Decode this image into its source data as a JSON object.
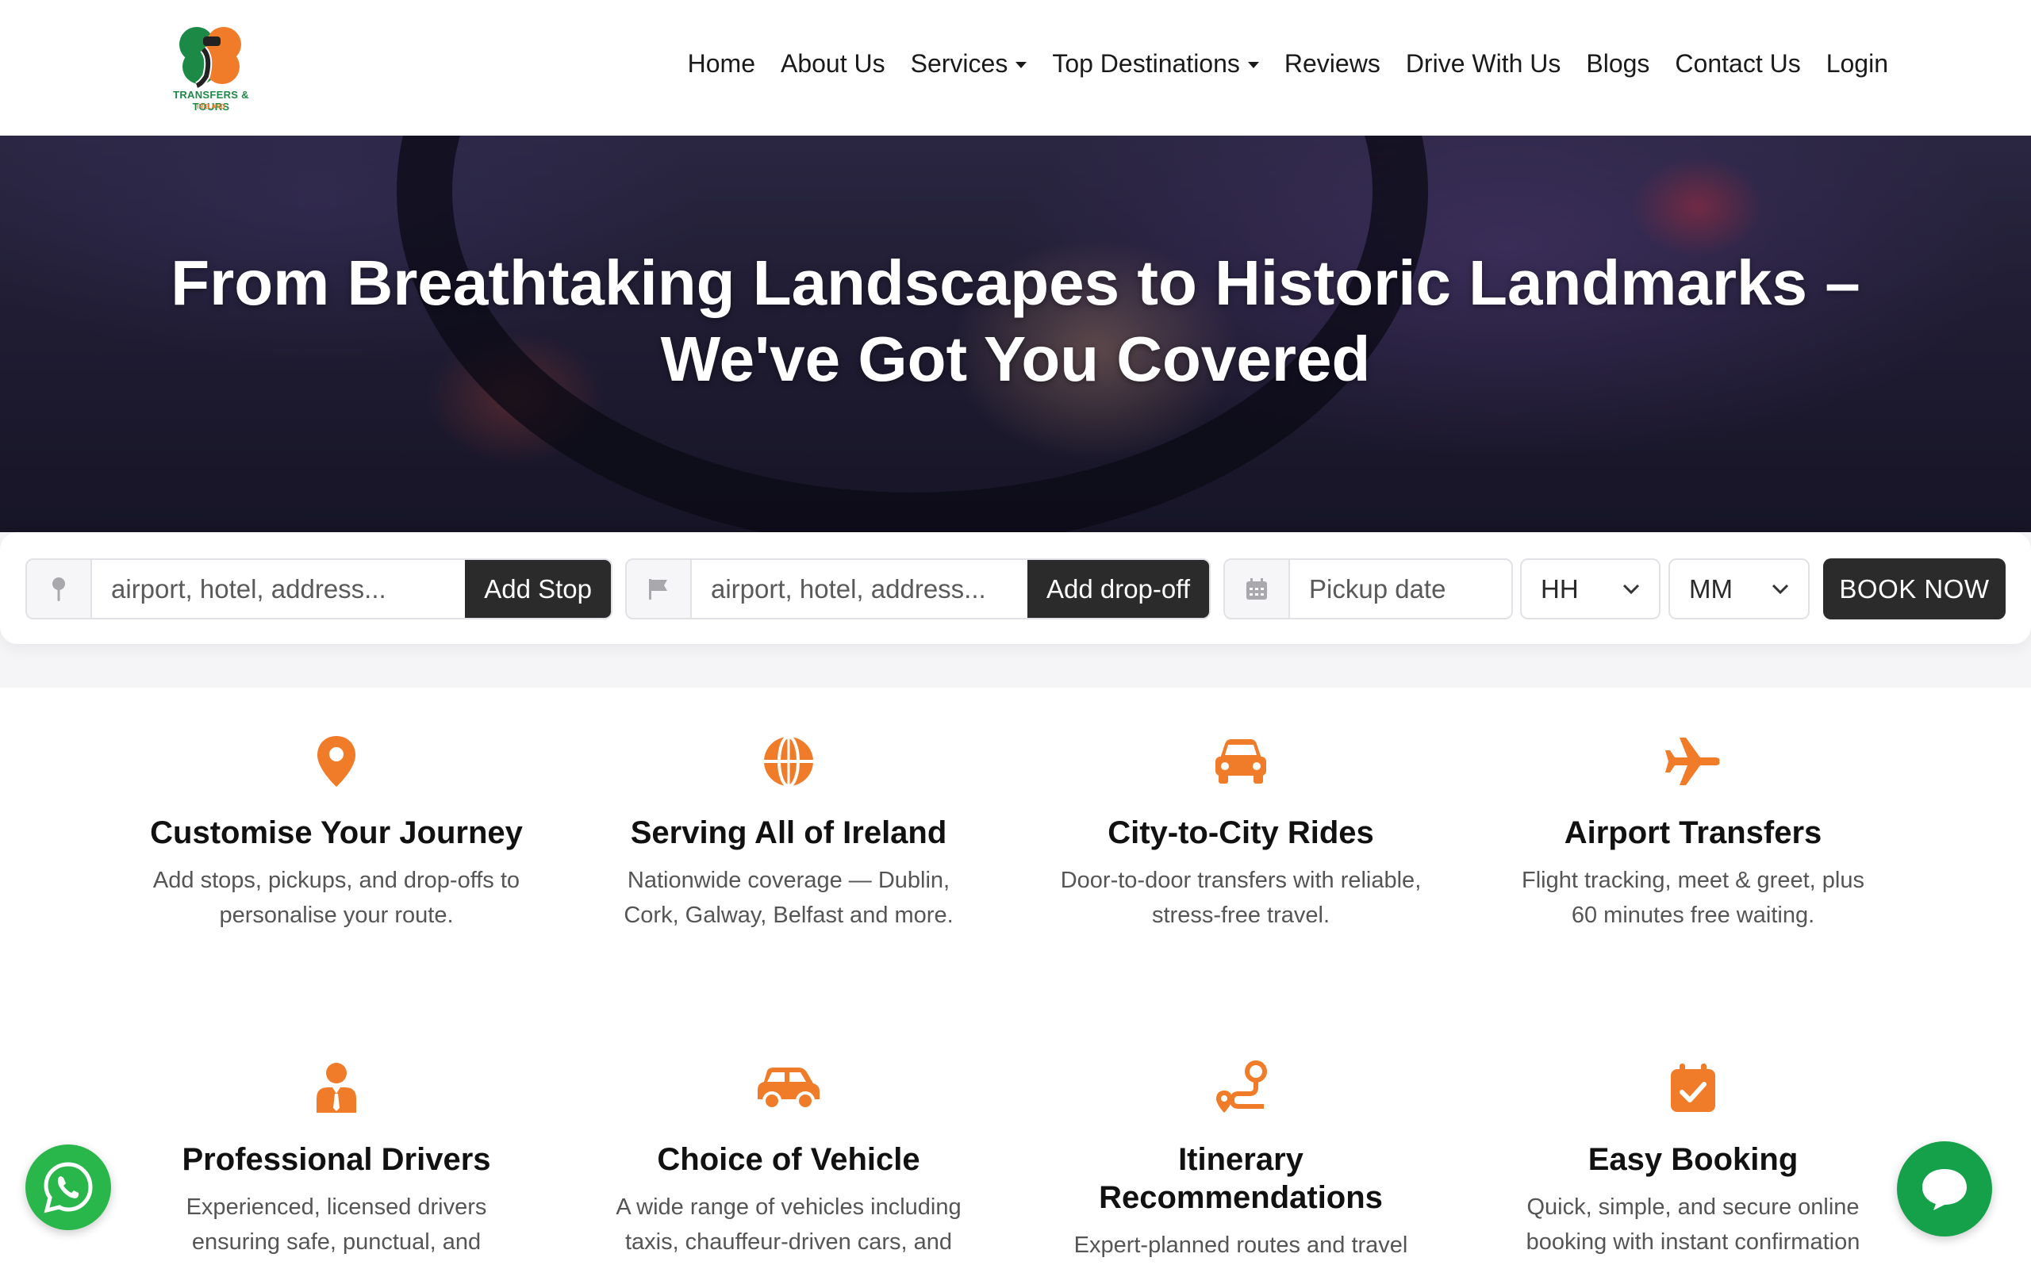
{
  "brand": {
    "logo_text": "TRANSFERS & TOURS",
    "logo_sub": "IRELAND",
    "colors": {
      "orange": "#f07c2a",
      "green": "#1c8a46",
      "dark": "#2b2b2b"
    }
  },
  "nav": {
    "items": [
      {
        "label": "Home",
        "dropdown": false
      },
      {
        "label": "About Us",
        "dropdown": false
      },
      {
        "label": "Services",
        "dropdown": true
      },
      {
        "label": "Top Destinations",
        "dropdown": true
      },
      {
        "label": "Reviews",
        "dropdown": false
      },
      {
        "label": "Drive With Us",
        "dropdown": false
      },
      {
        "label": "Blogs",
        "dropdown": false
      },
      {
        "label": "Contact Us",
        "dropdown": false
      },
      {
        "label": "Login",
        "dropdown": false
      }
    ]
  },
  "hero": {
    "title_line1": "From Breathtaking Landscapes to Historic Landmarks –",
    "title_line2": "We've Got You Covered"
  },
  "booking": {
    "pickup_placeholder": "airport, hotel, address...",
    "add_stop": "Add Stop",
    "dropoff_placeholder": "airport, hotel, address...",
    "add_dropoff": "Add drop-off",
    "date_placeholder": "Pickup date",
    "hour": "HH",
    "minute": "MM",
    "book_now": "BOOK NOW"
  },
  "features": [
    {
      "icon": "map-pin-icon",
      "title": "Customise Your Journey",
      "text1": "Add stops, pickups, and drop-offs to",
      "text2": "personalise your route."
    },
    {
      "icon": "globe-icon",
      "title": "Serving All of Ireland",
      "text1": "Nationwide coverage — Dublin,",
      "text2": "Cork, Galway, Belfast and more."
    },
    {
      "icon": "car-front-icon",
      "title": "City-to-City Rides",
      "text1": "Door-to-door transfers with reliable,",
      "text2": "stress-free travel."
    },
    {
      "icon": "plane-icon",
      "title": "Airport Transfers",
      "text1": "Flight tracking, meet & greet, plus",
      "text2": "60 minutes free waiting."
    },
    {
      "icon": "driver-icon",
      "title": "Professional Drivers",
      "text1": "Experienced, licensed drivers",
      "text2": "ensuring safe, punctual, and"
    },
    {
      "icon": "car-side-icon",
      "title": "Choice of Vehicle",
      "text1": "A wide range of vehicles including",
      "text2": "taxis, chauffeur-driven cars, and"
    },
    {
      "icon": "route-icon",
      "title": "Itinerary",
      "title2": "Recommendations",
      "text1": "Expert-planned routes and travel",
      "text2": ""
    },
    {
      "icon": "calendar-check-icon",
      "title": "Easy Booking",
      "text1": "Quick, simple, and secure online",
      "text2": "booking with instant confirmation"
    }
  ]
}
